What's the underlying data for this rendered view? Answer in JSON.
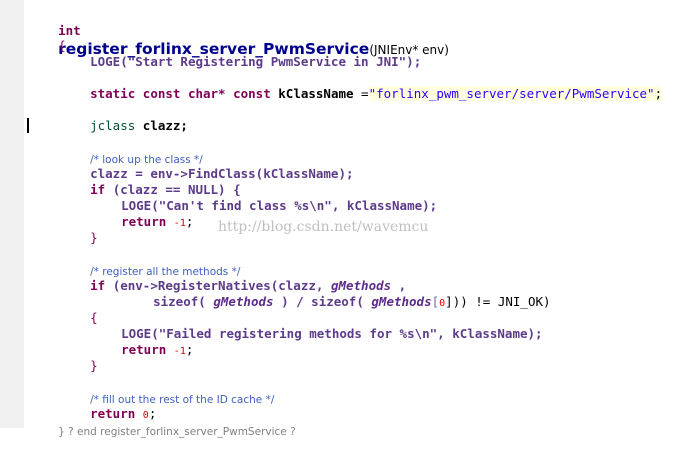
{
  "editor": {
    "func_type": "int",
    "func_name": "register_forlinx_server_PwmService",
    "func_params": "(JNIEnv* env)",
    "open_brace": "{",
    "logd_call": "LOGE(\"Start Registering PwmService in JNI\");",
    "static_line_prefix": "static const char* const ",
    "kClassName": "kClassName",
    "assign": " =",
    "class_string": "\"forlinx_pwm_server/server/PwmService\"",
    "semicolon": ";",
    "jclass_kw": "jclass ",
    "jclass_var": "clazz;",
    "cmt_lookup": "/* look up the class */",
    "find_class": "clazz = env->FindClass(kClassName);",
    "if_kw": "if ",
    "if_null": "(clazz == NULL) {",
    "loge1": "LOGE(\"Can't find class %s\\n\", kClassName);",
    "return_kw": "return ",
    "neg_one": "-1",
    "close_brace": "}",
    "cmt_register": "/* register all the methods */",
    "if_register": "(env->RegisterNatives(clazz, ",
    "gMethods": "gMethods",
    "sizeof_line_a": "sizeof( ",
    "sizeof_line_b": " ) / sizeof( ",
    "sizeof_line_c": "[",
    "zero": "0",
    "sizeof_line_d": "])) != JNI_OK)",
    "loge2": "LOGE(\"Failed registering methods for %s\\n\", kClassName);",
    "cmt_fill": "/* fill out the rest of the ID cache */",
    "return_zero_num": "0",
    "end_comment": "} ? end register_forlinx_server_PwmService ?",
    "watermark": "http://blog.csdn.net/wavemcu"
  },
  "colors": {
    "keyword": "#7f0055",
    "string": "#2a00ff",
    "comment": "#3f5fbf",
    "highlight": "#ffffe0",
    "function_title": "#00008b"
  }
}
